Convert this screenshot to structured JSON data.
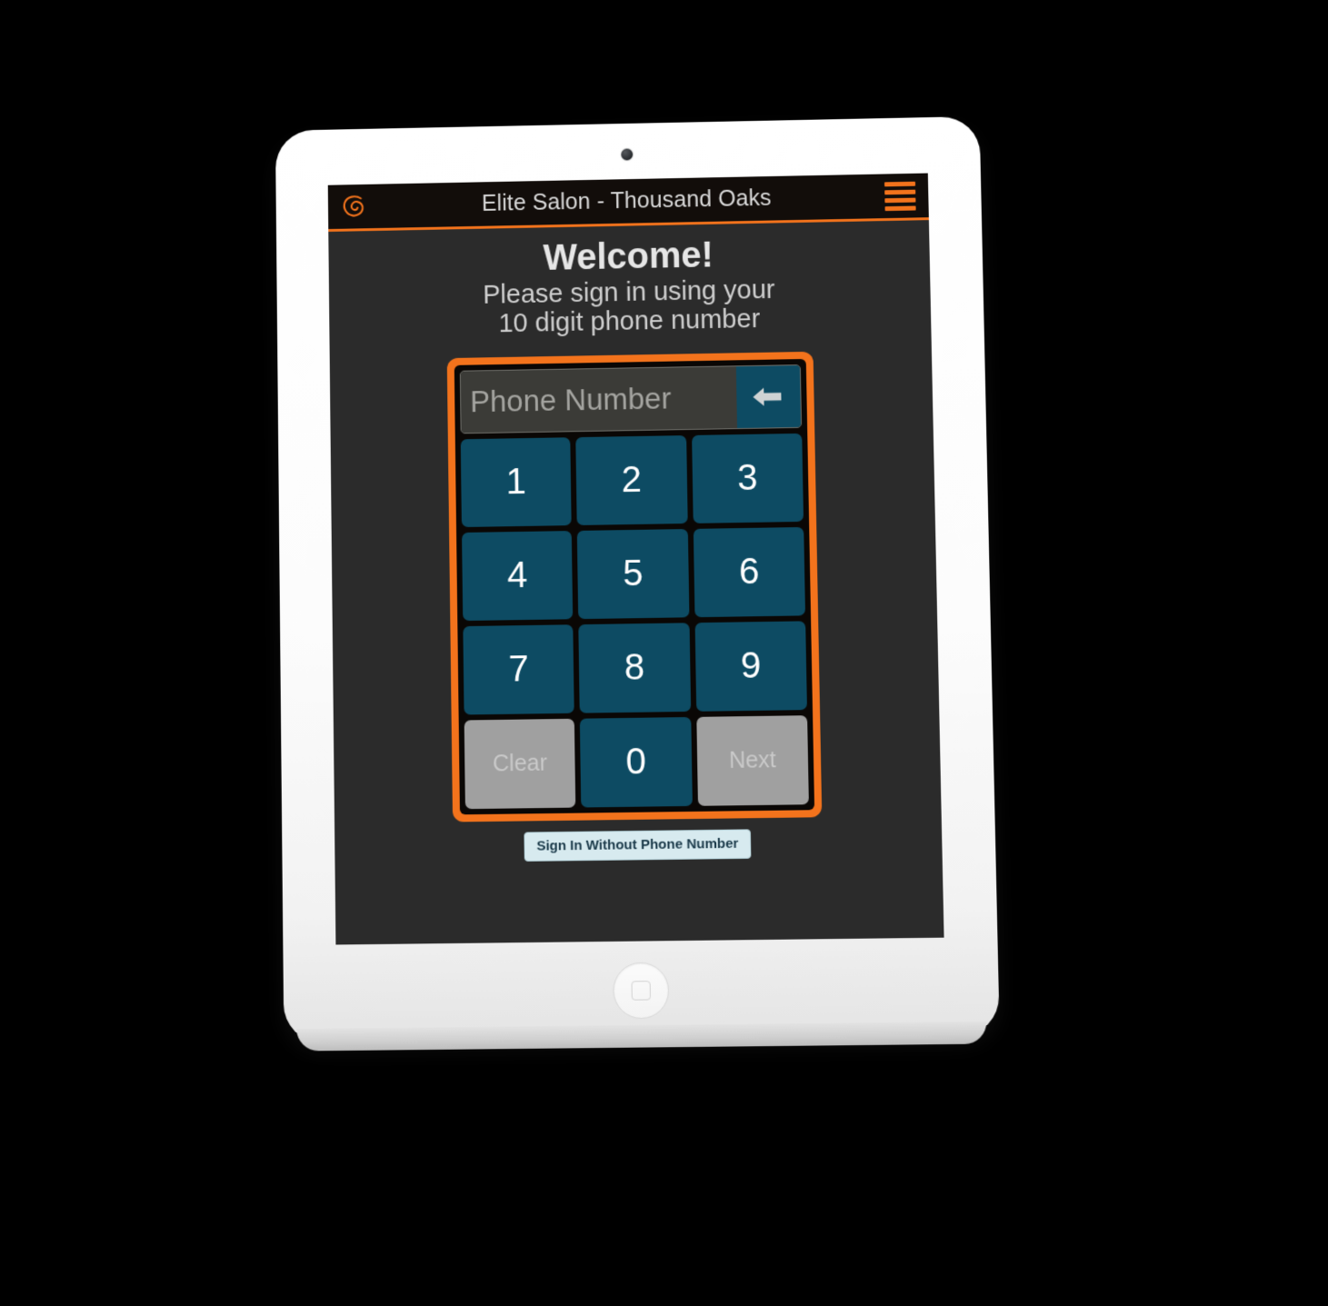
{
  "device": {
    "type": "tablet",
    "camera": "camera-dot",
    "home_button": "home-button"
  },
  "header": {
    "logo_icon": "spiral-logo-icon",
    "title": "Elite Salon - Thousand Oaks",
    "menu_icon": "hamburger-menu-icon",
    "background_color": "#120d0a",
    "accent_color": "#f3731c"
  },
  "main": {
    "heading": "Welcome!",
    "subtitle_line1": "Please sign in using your",
    "subtitle_line2": "10 digit phone number"
  },
  "keypad": {
    "frame_color": "#f3731c",
    "display": {
      "value": "",
      "placeholder": "Phone Number",
      "backspace_icon": "backspace-arrow-icon",
      "backspace_color": "#0d4b63"
    },
    "digit_color": "#0d4b63",
    "action_color": "#a0a0a0",
    "keys": [
      {
        "label": "1",
        "kind": "digit"
      },
      {
        "label": "2",
        "kind": "digit"
      },
      {
        "label": "3",
        "kind": "digit"
      },
      {
        "label": "4",
        "kind": "digit"
      },
      {
        "label": "5",
        "kind": "digit"
      },
      {
        "label": "6",
        "kind": "digit"
      },
      {
        "label": "7",
        "kind": "digit"
      },
      {
        "label": "8",
        "kind": "digit"
      },
      {
        "label": "9",
        "kind": "digit"
      },
      {
        "label": "Clear",
        "kind": "action"
      },
      {
        "label": "0",
        "kind": "digit"
      },
      {
        "label": "Next",
        "kind": "action"
      }
    ]
  },
  "footer": {
    "signin_without_label": "Sign In Without Phone Number",
    "signin_without_bg": "#d7eaef",
    "signin_without_fg": "#1b3a4a"
  }
}
